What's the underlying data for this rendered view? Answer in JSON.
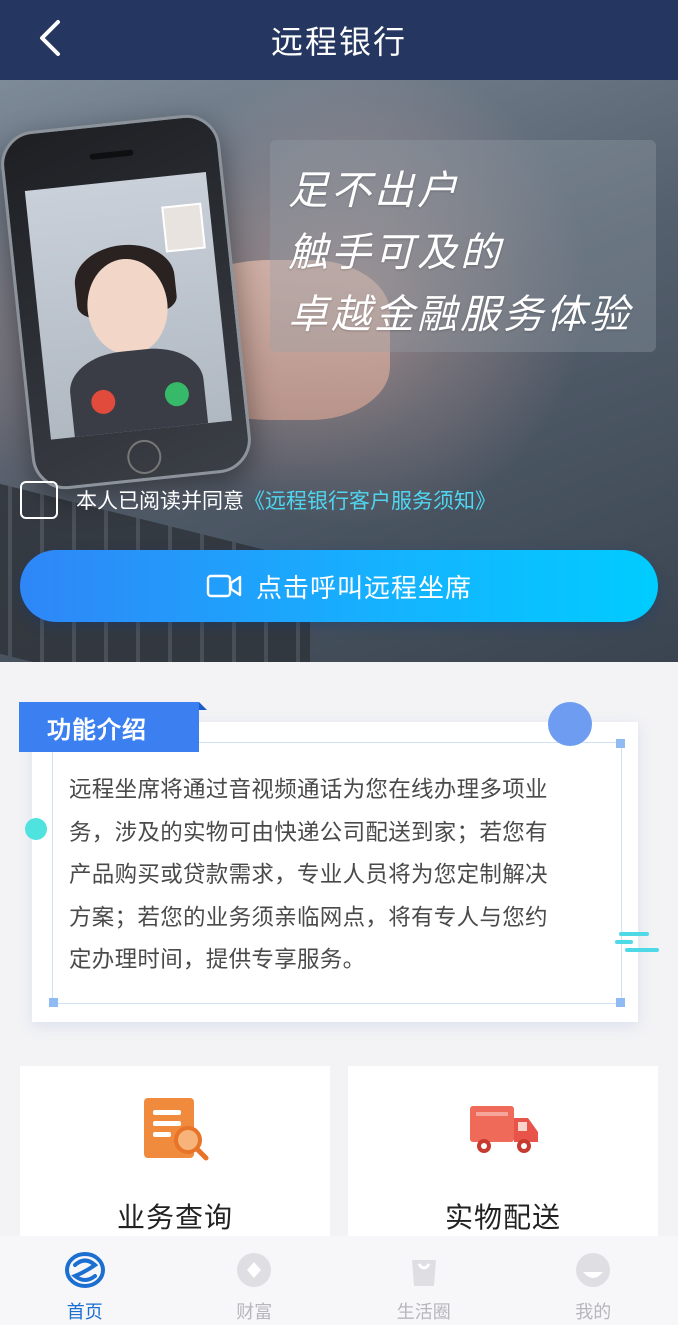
{
  "header": {
    "title": "远程银行",
    "back_icon": "chevron-left-icon"
  },
  "banner": {
    "slogan_lines": [
      "足不出户",
      "触手可及的",
      "卓越金融服务体验"
    ],
    "agreement_prefix": "本人已阅读并同意",
    "agreement_link": "《远程银行客户服务须知》",
    "call_button_label": "点击呼叫远程坐席",
    "call_button_icon": "video-camera-icon"
  },
  "intro": {
    "tag": "功能介绍",
    "lines": [
      "远程坐席将通过音视频通话为您在线办理多项业",
      "务，涉及的实物可由快递公司配送到家；若您有",
      "产品购买或贷款需求，专业人员将为您定制解决",
      "方案；若您的业务须亲临网点，将有专人与您约",
      "定办理时间，提供专享服务。"
    ]
  },
  "services": [
    {
      "label": "业务查询",
      "icon": "document-search-icon"
    },
    {
      "label": "实物配送",
      "icon": "delivery-truck-icon"
    }
  ],
  "tabbar": {
    "items": [
      {
        "label": "首页",
        "icon": "bank-logo-icon",
        "active": true
      },
      {
        "label": "财富",
        "icon": "wealth-icon",
        "active": false
      },
      {
        "label": "生活圈",
        "icon": "shopping-bag-icon",
        "active": false
      },
      {
        "label": "我的",
        "icon": "profile-icon",
        "active": false
      }
    ]
  },
  "colors": {
    "header_bg": "#253760",
    "accent_blue": "#3b7ff0",
    "link_cyan": "#4fd6f0",
    "tab_active": "#1a6fd0"
  }
}
